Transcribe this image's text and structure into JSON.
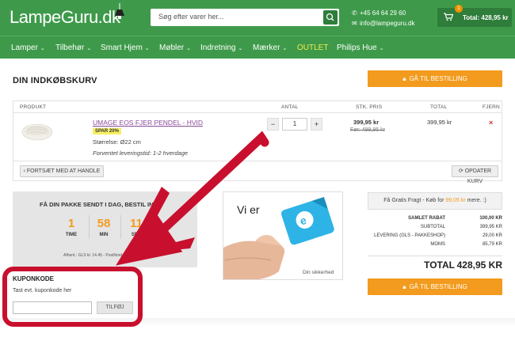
{
  "header": {
    "logo": "LampeGuru.dk",
    "search_placeholder": "Søg efter varer her...",
    "phone": "+45 64 64 29 60",
    "email": "info@lampeguru.dk",
    "cart_count": "1",
    "cart_total": "Total: 428,95 kr"
  },
  "nav": {
    "items": [
      "Lamper",
      "Tilbehør",
      "Smart Hjem",
      "Møbler",
      "Indretning",
      "Mærker",
      "OUTLET",
      "Philips Hue"
    ]
  },
  "page": {
    "title": "DIN INDKØBSKURV",
    "checkout_label": "GÅ TIL BESTILLING"
  },
  "table": {
    "headers": {
      "product": "PRODUKT",
      "qty": "ANTAL",
      "unit_price": "STK. PRIS",
      "total": "TOTAL",
      "remove": "FJERN"
    },
    "row": {
      "name": "UMAGE EOS FJER PENDEL - HVID",
      "badge": "SPAR 20%",
      "size": "Størrelse:   Ø22 cm",
      "delivery": "Forventet leveringstid: 1-2 hverdage",
      "qty": "1",
      "price": "399,95 kr",
      "old_price": "Før: 499,95 kr",
      "total": "399,95 kr",
      "remove_icon": "×"
    },
    "continue_label": "FORTSÆT MED AT HANDLE",
    "update_label": "OPDATER KURV"
  },
  "countdown": {
    "title": "FÅ DIN PAKKE SENDT I DAG, BESTIL INDE",
    "hours": "1",
    "minutes": "58",
    "seconds": "11",
    "hours_label": "TIME",
    "minutes_label": "MIN",
    "seconds_label": "SEK",
    "note": "Afhent.: GLS kl. 14.45 - PostNord kl. 16.45"
  },
  "emark": {
    "text": "Vi er",
    "card_label": "e-mærket",
    "footer": "Din sikkerhed"
  },
  "summary": {
    "fragt_prefix": "Få Gratis Fragt - Køb for",
    "fragt_amount": "99,05 kr",
    "fragt_suffix": "mere. :)",
    "rows": [
      {
        "label": "SAMLET RABAT",
        "value": "100,00 KR"
      },
      {
        "label": "SUBTOTAL",
        "value": "399,95 KR"
      },
      {
        "label": "LEVERING (GLS - PAKKESHOP)",
        "value": "29,00 KR"
      },
      {
        "label": "MOMS",
        "value": "85,79 KR"
      }
    ],
    "total_label": "TOTAL",
    "total_value": "428,95 KR"
  },
  "coupon": {
    "title": "KUPONKODE",
    "hint": "Tast evt. kuponkode her",
    "button": "TILFØJ"
  },
  "colors": {
    "brand_green": "#3e9a4a",
    "accent_orange": "#f39b1e",
    "annotation_red": "#c8102e"
  }
}
